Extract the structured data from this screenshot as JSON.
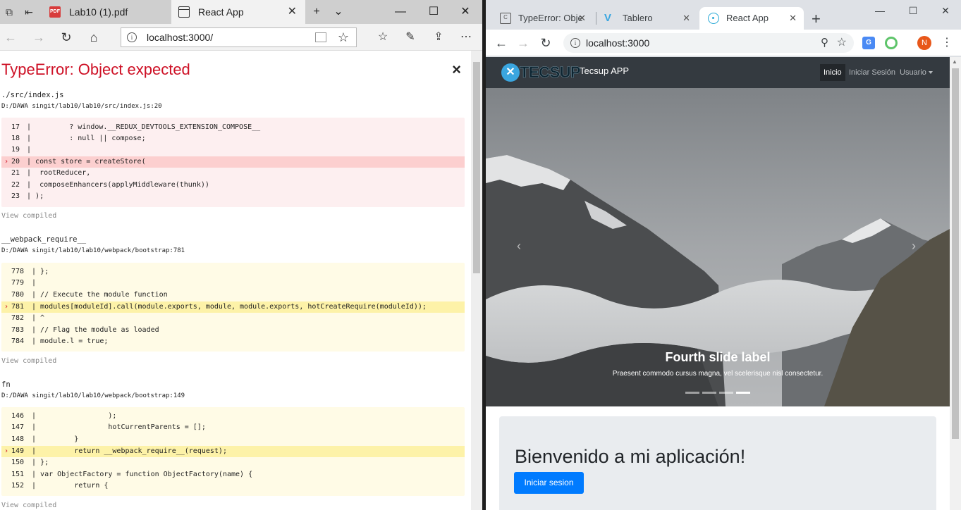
{
  "edge": {
    "tabs": [
      {
        "title": "Lab10 (1).pdf",
        "icon": "pdf-icon"
      },
      {
        "title": "React App",
        "icon": "page-icon",
        "active": true
      }
    ],
    "address": {
      "url": "localhost:3000/"
    },
    "error": {
      "title": "TypeError: Object expected",
      "close": "×",
      "view_compiled": "View compiled",
      "frames": [
        {
          "name": "./src/index.js",
          "path": "D:/DAWA singit/lab10/lab10/src/index.js:20",
          "style": "red",
          "lines": [
            {
              "num": "17",
              "code": " |         ? window.__REDUX_DEVTOOLS_EXTENSION_COMPOSE__",
              "hl": false
            },
            {
              "num": "18",
              "code": " |         : null || compose;",
              "hl": false
            },
            {
              "num": "19",
              "code": " |",
              "hl": false
            },
            {
              "num": "20",
              "code": " | const store = createStore(",
              "hl": true
            },
            {
              "num": "21",
              "code": " |  rootReducer,",
              "hl": false
            },
            {
              "num": "22",
              "code": " |  composeEnhancers(applyMiddleware(thunk))",
              "hl": false
            },
            {
              "num": "23",
              "code": " | );",
              "hl": false
            }
          ]
        },
        {
          "name": "__webpack_require__",
          "path": "D:/DAWA singit/lab10/lab10/webpack/bootstrap:781",
          "style": "yellow",
          "lines": [
            {
              "num": "778",
              "code": " | };",
              "hl": false
            },
            {
              "num": "779",
              "code": " |",
              "hl": false
            },
            {
              "num": "780",
              "code": " | // Execute the module function",
              "hl": false
            },
            {
              "num": "781",
              "code": " | modules[moduleId].call(module.exports, module, module.exports, hotCreateRequire(moduleId));",
              "hl": true
            },
            {
              "num": "782",
              "code": " | ^",
              "hl": false
            },
            {
              "num": "783",
              "code": " | // Flag the module as loaded",
              "hl": false
            },
            {
              "num": "784",
              "code": " | module.l = true;",
              "hl": false
            }
          ]
        },
        {
          "name": "fn",
          "path": "D:/DAWA singit/lab10/lab10/webpack/bootstrap:149",
          "style": "yellow",
          "lines": [
            {
              "num": "146",
              "code": " |                 );",
              "hl": false
            },
            {
              "num": "147",
              "code": " |                 hotCurrentParents = [];",
              "hl": false
            },
            {
              "num": "148",
              "code": " |         }",
              "hl": false
            },
            {
              "num": "149",
              "code": " |         return __webpack_require__(request);",
              "hl": true
            },
            {
              "num": "150",
              "code": " | };",
              "hl": false
            },
            {
              "num": "151",
              "code": " | var ObjectFactory = function ObjectFactory(name) {",
              "hl": false
            },
            {
              "num": "152",
              "code": " |         return {",
              "hl": false
            }
          ]
        }
      ]
    }
  },
  "chrome": {
    "tabs": [
      {
        "title": "TypeError: Obje",
        "icon": "doc-icon"
      },
      {
        "title": "Tablero",
        "icon": "v-icon"
      },
      {
        "title": "React App",
        "icon": "react-icon",
        "active": true
      }
    ],
    "address": {
      "url": "localhost:3000"
    },
    "profile_initial": "N",
    "app": {
      "logo_text": "TECSUP",
      "brand": "Tecsup APP",
      "nav": [
        {
          "label": "Inicio",
          "active": true
        },
        {
          "label": "Iniciar Sesión",
          "active": false
        },
        {
          "label": "Usuario",
          "active": false,
          "dropdown": true
        }
      ],
      "carousel": {
        "caption_title": "Fourth slide label",
        "caption_text": "Praesent commodo cursus magna, vel scelerisque nisl consectetur.",
        "slides": 4,
        "active_index": 3,
        "prev": "‹",
        "next": "›"
      },
      "jumbotron": {
        "title": "Bienvenido a mi aplicación!",
        "button": "Iniciar sesion"
      }
    }
  },
  "colors": {
    "error_red": "#ce1126",
    "primary": "#007bff",
    "navbar": "#343a40",
    "jumbotron": "#e9ecef"
  }
}
